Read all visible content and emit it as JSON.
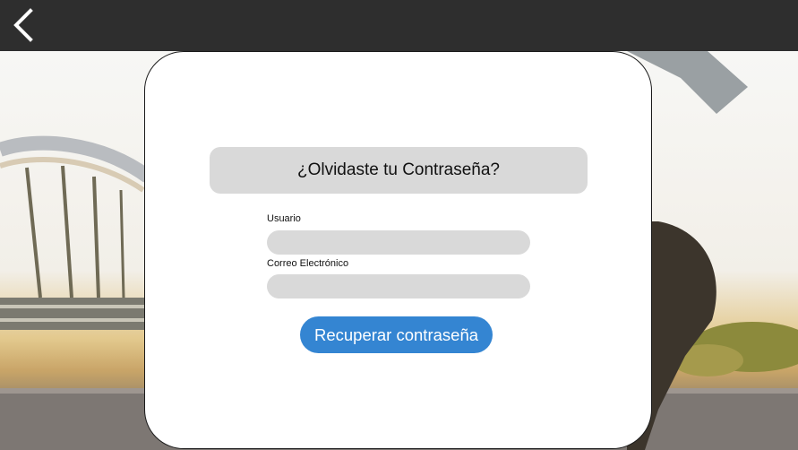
{
  "header": {
    "back_icon": "chevron-left-icon",
    "background_color": "#2e2e2e"
  },
  "form": {
    "title": "¿Olvidaste tu Contraseña?",
    "username_label": "Usuario",
    "username_value": "",
    "email_label": "Correo Electrónico",
    "email_value": "",
    "submit_label": "Recuperar contraseña"
  },
  "colors": {
    "accent": "#3485d2",
    "field_background": "#d9d9d9",
    "card_background": "#ffffff"
  }
}
